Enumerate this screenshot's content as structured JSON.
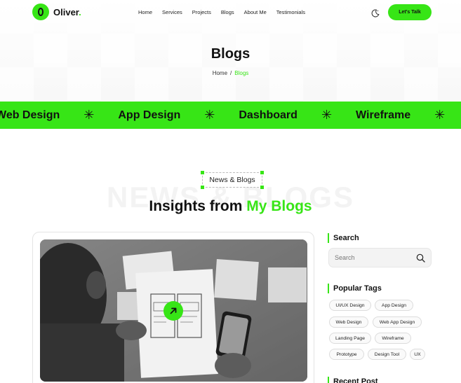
{
  "nav": {
    "logo_text": "Oliver",
    "logo_dot": ".",
    "items": [
      "Home",
      "Services",
      "Projects",
      "Blogs",
      "About Me",
      "Testimonials"
    ],
    "cta_label": "Let's Talk",
    "theme_icon": "moon-icon"
  },
  "hero": {
    "title": "Blogs",
    "breadcrumb": {
      "home": "Home",
      "separator": "/",
      "current": "Blogs"
    }
  },
  "band": {
    "items": [
      "Web Design",
      "App Design",
      "Dashboard",
      "Wireframe"
    ],
    "separator": "✳"
  },
  "section": {
    "eyebrow": "News & Blogs",
    "ghost_text": "NEWS & BLOGS",
    "title_main": "Insights from",
    "title_accent": "My Blogs"
  },
  "card": {
    "image_icon": "wireframe-photo",
    "arrow_icon": "arrow-up-right-icon"
  },
  "sidebar": {
    "search_heading": "Search",
    "search_placeholder": "Search",
    "tags_heading": "Popular Tags",
    "tags": [
      "UI/UX Design",
      "App Design",
      "Web Design",
      "Web App Design",
      "Landing Page",
      "Wireframe",
      "Prototype",
      "Design Tool",
      "UX"
    ],
    "recent_heading": "Recent Post"
  },
  "colors": {
    "accent": "#37e516",
    "text": "#111111"
  }
}
